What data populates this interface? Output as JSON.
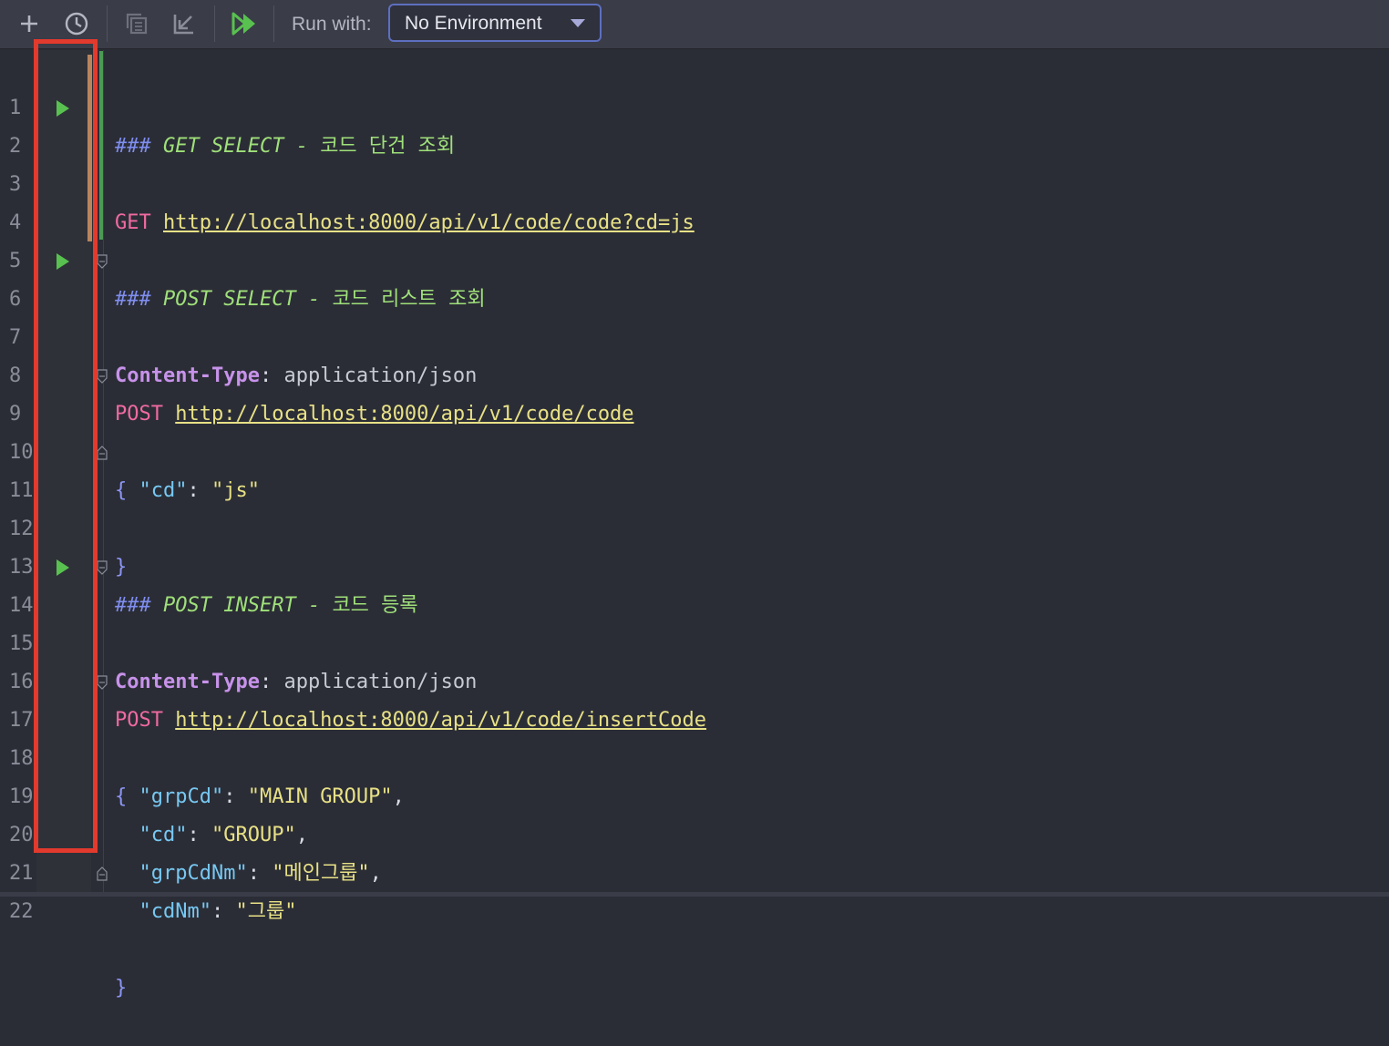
{
  "toolbar": {
    "run_with_label": "Run with:",
    "environment": "No Environment"
  },
  "editor": {
    "line_numbers": [
      "1",
      "2",
      "3",
      "4",
      "5",
      "6",
      "7",
      "8",
      "9",
      "10",
      "11",
      "12",
      "13",
      "14",
      "15",
      "16",
      "17",
      "18",
      "19",
      "20",
      "21",
      "22"
    ],
    "lines": {
      "l1": {
        "hash": "###",
        "title": "GET SELECT - ",
        "korean": "코드 단건 조회"
      },
      "l2": {
        "method": "GET",
        "url": "http://localhost:8000/api/v1/code/code?cd=js"
      },
      "l5": {
        "hash": "###",
        "title": "POST SELECT - ",
        "korean": "코드 리스트 조회"
      },
      "l6": {
        "method": "POST",
        "url": "http://localhost:8000/api/v1/code/code"
      },
      "l7": {
        "header": "Content-Type",
        "colon": ": ",
        "value": "application/json"
      },
      "l9": {
        "brace": "{"
      },
      "l10": {
        "indent": "  ",
        "key": "\"cd\"",
        "colon": ": ",
        "value": "\"js\""
      },
      "l11": {
        "brace": "}"
      },
      "l13": {
        "hash": "###",
        "title": "POST INSERT - ",
        "korean": "코드 등록"
      },
      "l14": {
        "method": "POST",
        "url": "http://localhost:8000/api/v1/code/insertCode"
      },
      "l15": {
        "header": "Content-Type",
        "colon": ": ",
        "value": "application/json"
      },
      "l17": {
        "brace": "{"
      },
      "l18": {
        "indent": "  ",
        "key": "\"grpCd\"",
        "colon": ": ",
        "value": "\"MAIN GROUP\"",
        "comma": ","
      },
      "l19": {
        "indent": "  ",
        "key": "\"cd\"",
        "colon": ": ",
        "value": "\"GROUP\"",
        "comma": ","
      },
      "l20": {
        "indent": "  ",
        "key": "\"grpCdNm\"",
        "colon": ": ",
        "value": "\"메인그룹\"",
        "comma": ","
      },
      "l21": {
        "indent": "  ",
        "key": "\"cdNm\"",
        "colon": ": ",
        "value": "\"그룹\""
      },
      "l22": {
        "brace": "}"
      }
    }
  },
  "colors": {
    "highlight_box": "#e23a2d",
    "run_icon": "#58c14f",
    "method": "#f06aa0",
    "url": "#e8e186"
  }
}
